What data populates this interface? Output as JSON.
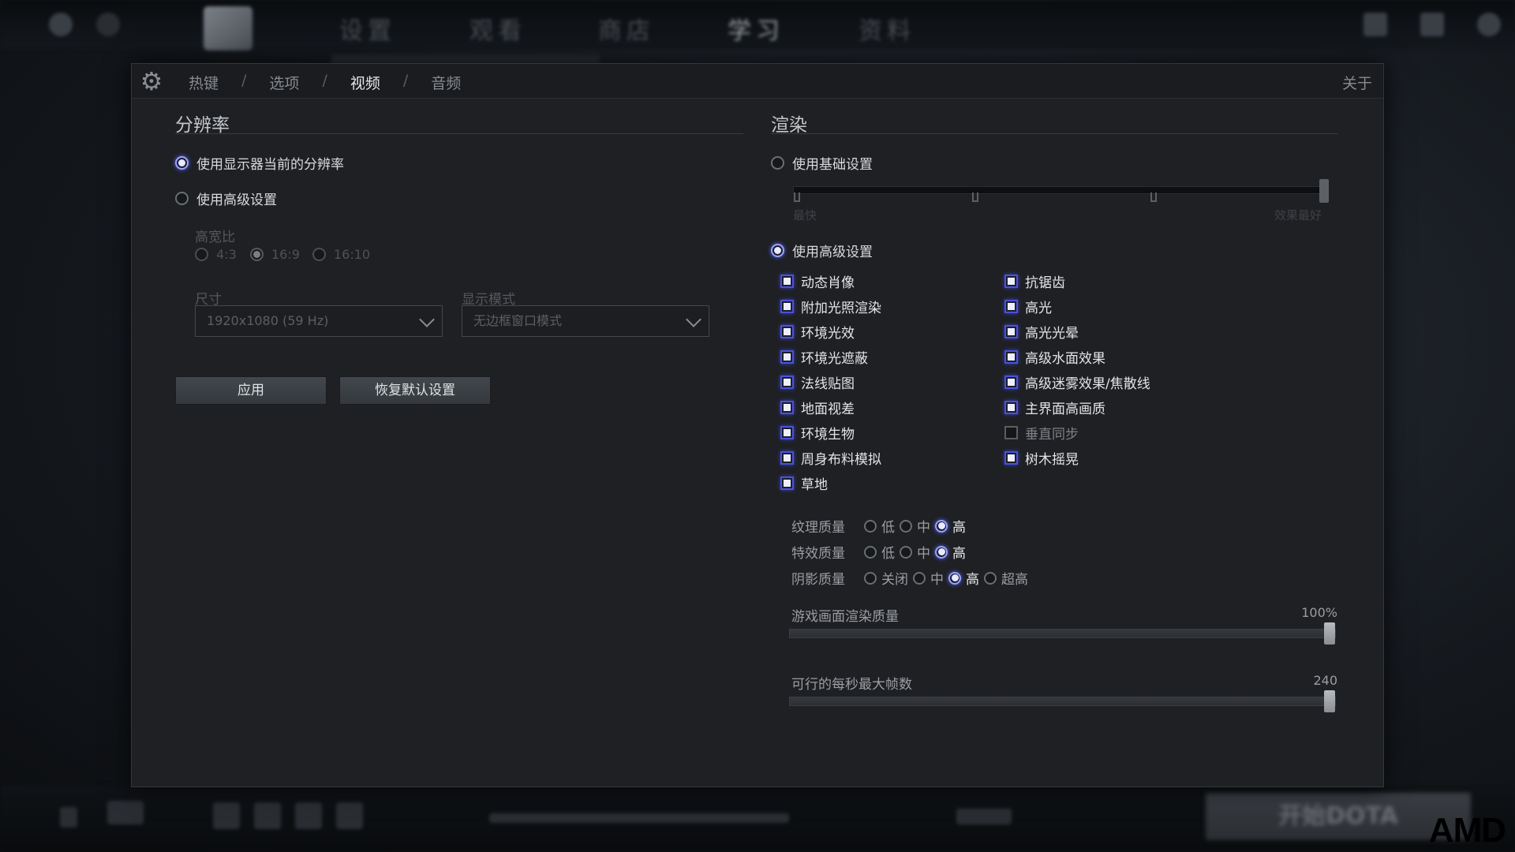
{
  "background": {
    "top_nav": [
      "设置",
      "观看",
      "商店",
      "学习",
      "资料"
    ],
    "play_button": "开始DOTA",
    "watermark": "AMD"
  },
  "header": {
    "tabs": [
      "热键",
      "选项",
      "视频",
      "音频"
    ],
    "active_tab": "视频",
    "about": "关于"
  },
  "resolution": {
    "title": "分辨率",
    "use_current": "使用显示器当前的分辨率",
    "use_advanced": "使用高级设置",
    "aspect_label": "高宽比",
    "aspect_options": [
      "4:3",
      "16:9",
      "16:10"
    ],
    "size_label": "尺寸",
    "size_value": "1920x1080 (59 Hz)",
    "display_mode_label": "显示模式",
    "display_mode_value": "无边框窗口模式",
    "apply": "应用",
    "restore": "恢复默认设置"
  },
  "render": {
    "title": "渲染",
    "use_basic": "使用基础设置",
    "basic_min": "最快",
    "basic_max": "效果最好",
    "use_advanced": "使用高级设置",
    "checks_left": [
      {
        "label": "动态肖像",
        "on": true
      },
      {
        "label": "附加光照渲染",
        "on": true
      },
      {
        "label": "环境光效",
        "on": true
      },
      {
        "label": "环境光遮蔽",
        "on": true
      },
      {
        "label": "法线贴图",
        "on": true
      },
      {
        "label": "地面视差",
        "on": true
      },
      {
        "label": "环境生物",
        "on": true
      },
      {
        "label": "周身布料模拟",
        "on": true
      },
      {
        "label": "草地",
        "on": true
      }
    ],
    "checks_right": [
      {
        "label": "抗锯齿",
        "on": true
      },
      {
        "label": "高光",
        "on": true
      },
      {
        "label": "高光光晕",
        "on": true
      },
      {
        "label": "高级水面效果",
        "on": true
      },
      {
        "label": "高级迷雾效果/焦散线",
        "on": true
      },
      {
        "label": "主界面高画质",
        "on": true
      },
      {
        "label": "垂直同步",
        "on": false
      },
      {
        "label": "树木摇晃",
        "on": true
      }
    ],
    "texture": {
      "label": "纹理质量",
      "options": [
        "低",
        "中",
        "高"
      ],
      "selected": "高"
    },
    "effects": {
      "label": "特效质量",
      "options": [
        "低",
        "中",
        "高"
      ],
      "selected": "高"
    },
    "shadow": {
      "label": "阴影质量",
      "options": [
        "关闭",
        "中",
        "高",
        "超高"
      ],
      "selected": "高"
    },
    "render_quality": {
      "label": "游戏画面渲染质量",
      "value_text": "100%",
      "fraction": 1.0
    },
    "max_fps": {
      "label": "可行的每秒最大帧数",
      "value_text": "240",
      "fraction": 1.0
    }
  }
}
